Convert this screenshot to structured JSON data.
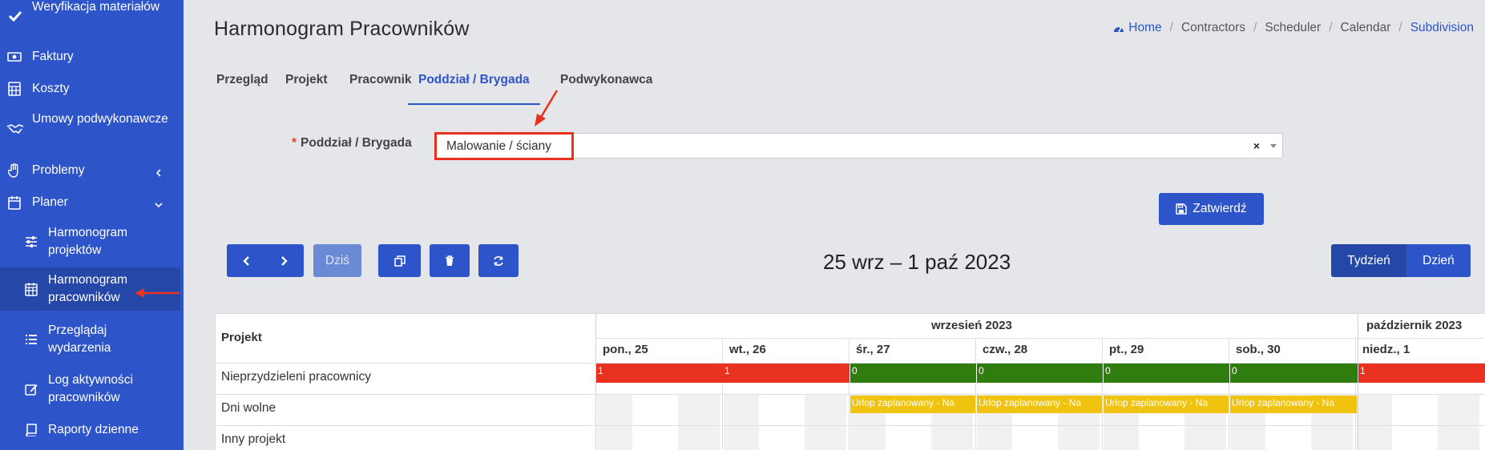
{
  "sidebar": {
    "items": [
      {
        "label": "Weryfikacja materiałów",
        "icon": "check-icon"
      },
      {
        "label": "Faktury",
        "icon": "money-bill-icon"
      },
      {
        "label": "Koszty",
        "icon": "calculator-icon"
      },
      {
        "label": "Umowy podwykonawcze",
        "icon": "handshake-icon"
      },
      {
        "label": "Problemy",
        "icon": "hand-icon"
      },
      {
        "label": "Planer",
        "icon": "calendar-icon"
      }
    ],
    "subitems": [
      {
        "label": "Harmonogram projektów",
        "icon": "sliders-icon"
      },
      {
        "label": "Harmonogram pracowników",
        "icon": "calendar-grid-icon"
      },
      {
        "label": "Przeglądaj wydarzenia",
        "icon": "list-icon"
      },
      {
        "label": "Log aktywności pracowników",
        "icon": "edit-icon"
      },
      {
        "label": "Raporty dzienne",
        "icon": "book-icon"
      }
    ]
  },
  "header": {
    "title": "Harmonogram Pracowników",
    "breadcrumb": [
      "Home",
      "Contractors",
      "Scheduler",
      "Calendar",
      "Subdivision"
    ]
  },
  "tabs": [
    "Przegląd",
    "Projekt",
    "Pracownik",
    "Poddział / Brygada",
    "Podwykonawca"
  ],
  "form": {
    "label": "Poddział / Brygada",
    "required_mark": "*",
    "selected_value": "Malowanie / ściany",
    "clear_symbol": "×",
    "submit_label": "Zatwierdź"
  },
  "toolbar": {
    "today_label": "Dziś",
    "period_title": "25 wrz – 1 paź 2023",
    "view_week": "Tydzień",
    "view_day": "Dzień"
  },
  "calendar": {
    "project_header": "Projekt",
    "months": [
      "wrzesień 2023",
      "październik 2023"
    ],
    "days": [
      "pon., 25",
      "wt., 26",
      "śr., 27",
      "czw., 28",
      "pt., 29",
      "sob., 30",
      "niedz., 1"
    ],
    "rows": [
      "Nieprzydzieleni pracownicy",
      "Dni wolne",
      "Inny projekt"
    ],
    "unassigned_counts": [
      "1",
      "1",
      "0",
      "0",
      "0",
      "0",
      "1"
    ],
    "leave_label": "Urlop zaplanowany - Na",
    "colors": {
      "red": "#e8321f",
      "green": "#2e7d0e",
      "yellow": "#f0c30f"
    }
  }
}
